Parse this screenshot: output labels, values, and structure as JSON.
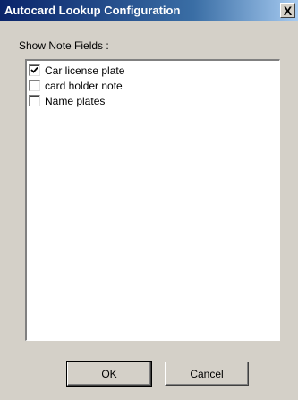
{
  "window": {
    "title": "Autocard Lookup Configuration",
    "close_label": "X"
  },
  "fields_label": "Show Note Fields :",
  "note_fields": [
    {
      "label": "Car license plate",
      "checked": true
    },
    {
      "label": "card holder note",
      "checked": false
    },
    {
      "label": "Name plates",
      "checked": false
    }
  ],
  "buttons": {
    "ok_label": "OK",
    "cancel_label": "Cancel"
  }
}
